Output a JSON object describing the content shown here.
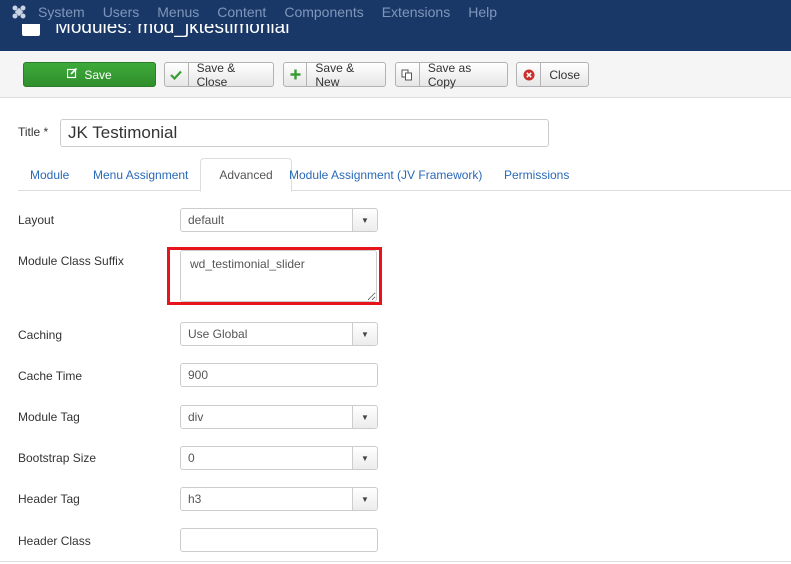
{
  "topbar": {
    "logo_icon": "joomla-logo-icon",
    "menu": [
      "System",
      "Users",
      "Menus",
      "Content",
      "Components",
      "Extensions",
      "Help"
    ]
  },
  "page_title": "Modules: mod_jktestimonial",
  "toolbar": {
    "save": "Save",
    "save_close": "Save & Close",
    "save_new": "Save & New",
    "save_copy": "Save as Copy",
    "close": "Close"
  },
  "title_field": {
    "label": "Title *",
    "value": "JK Testimonial"
  },
  "tabs": [
    "Module",
    "Menu Assignment",
    "Advanced",
    "Module Assignment (JV Framework)",
    "Permissions"
  ],
  "active_tab": "Advanced",
  "fields": {
    "layout": {
      "label": "Layout",
      "value": "default"
    },
    "module_class_suffix": {
      "label": "Module Class Suffix",
      "value": "wd_testimonial_slider"
    },
    "caching": {
      "label": "Caching",
      "value": "Use Global"
    },
    "cache_time": {
      "label": "Cache Time",
      "value": "900"
    },
    "module_tag": {
      "label": "Module Tag",
      "value": "div"
    },
    "bootstrap_size": {
      "label": "Bootstrap Size",
      "value": "0"
    },
    "header_tag": {
      "label": "Header Tag",
      "value": "h3"
    },
    "header_class": {
      "label": "Header Class",
      "value": ""
    }
  },
  "colors": {
    "topbar": "#1a3867",
    "save_green": "#35a032",
    "link_blue": "#2a69b8",
    "highlight_red": "#e8141b"
  }
}
